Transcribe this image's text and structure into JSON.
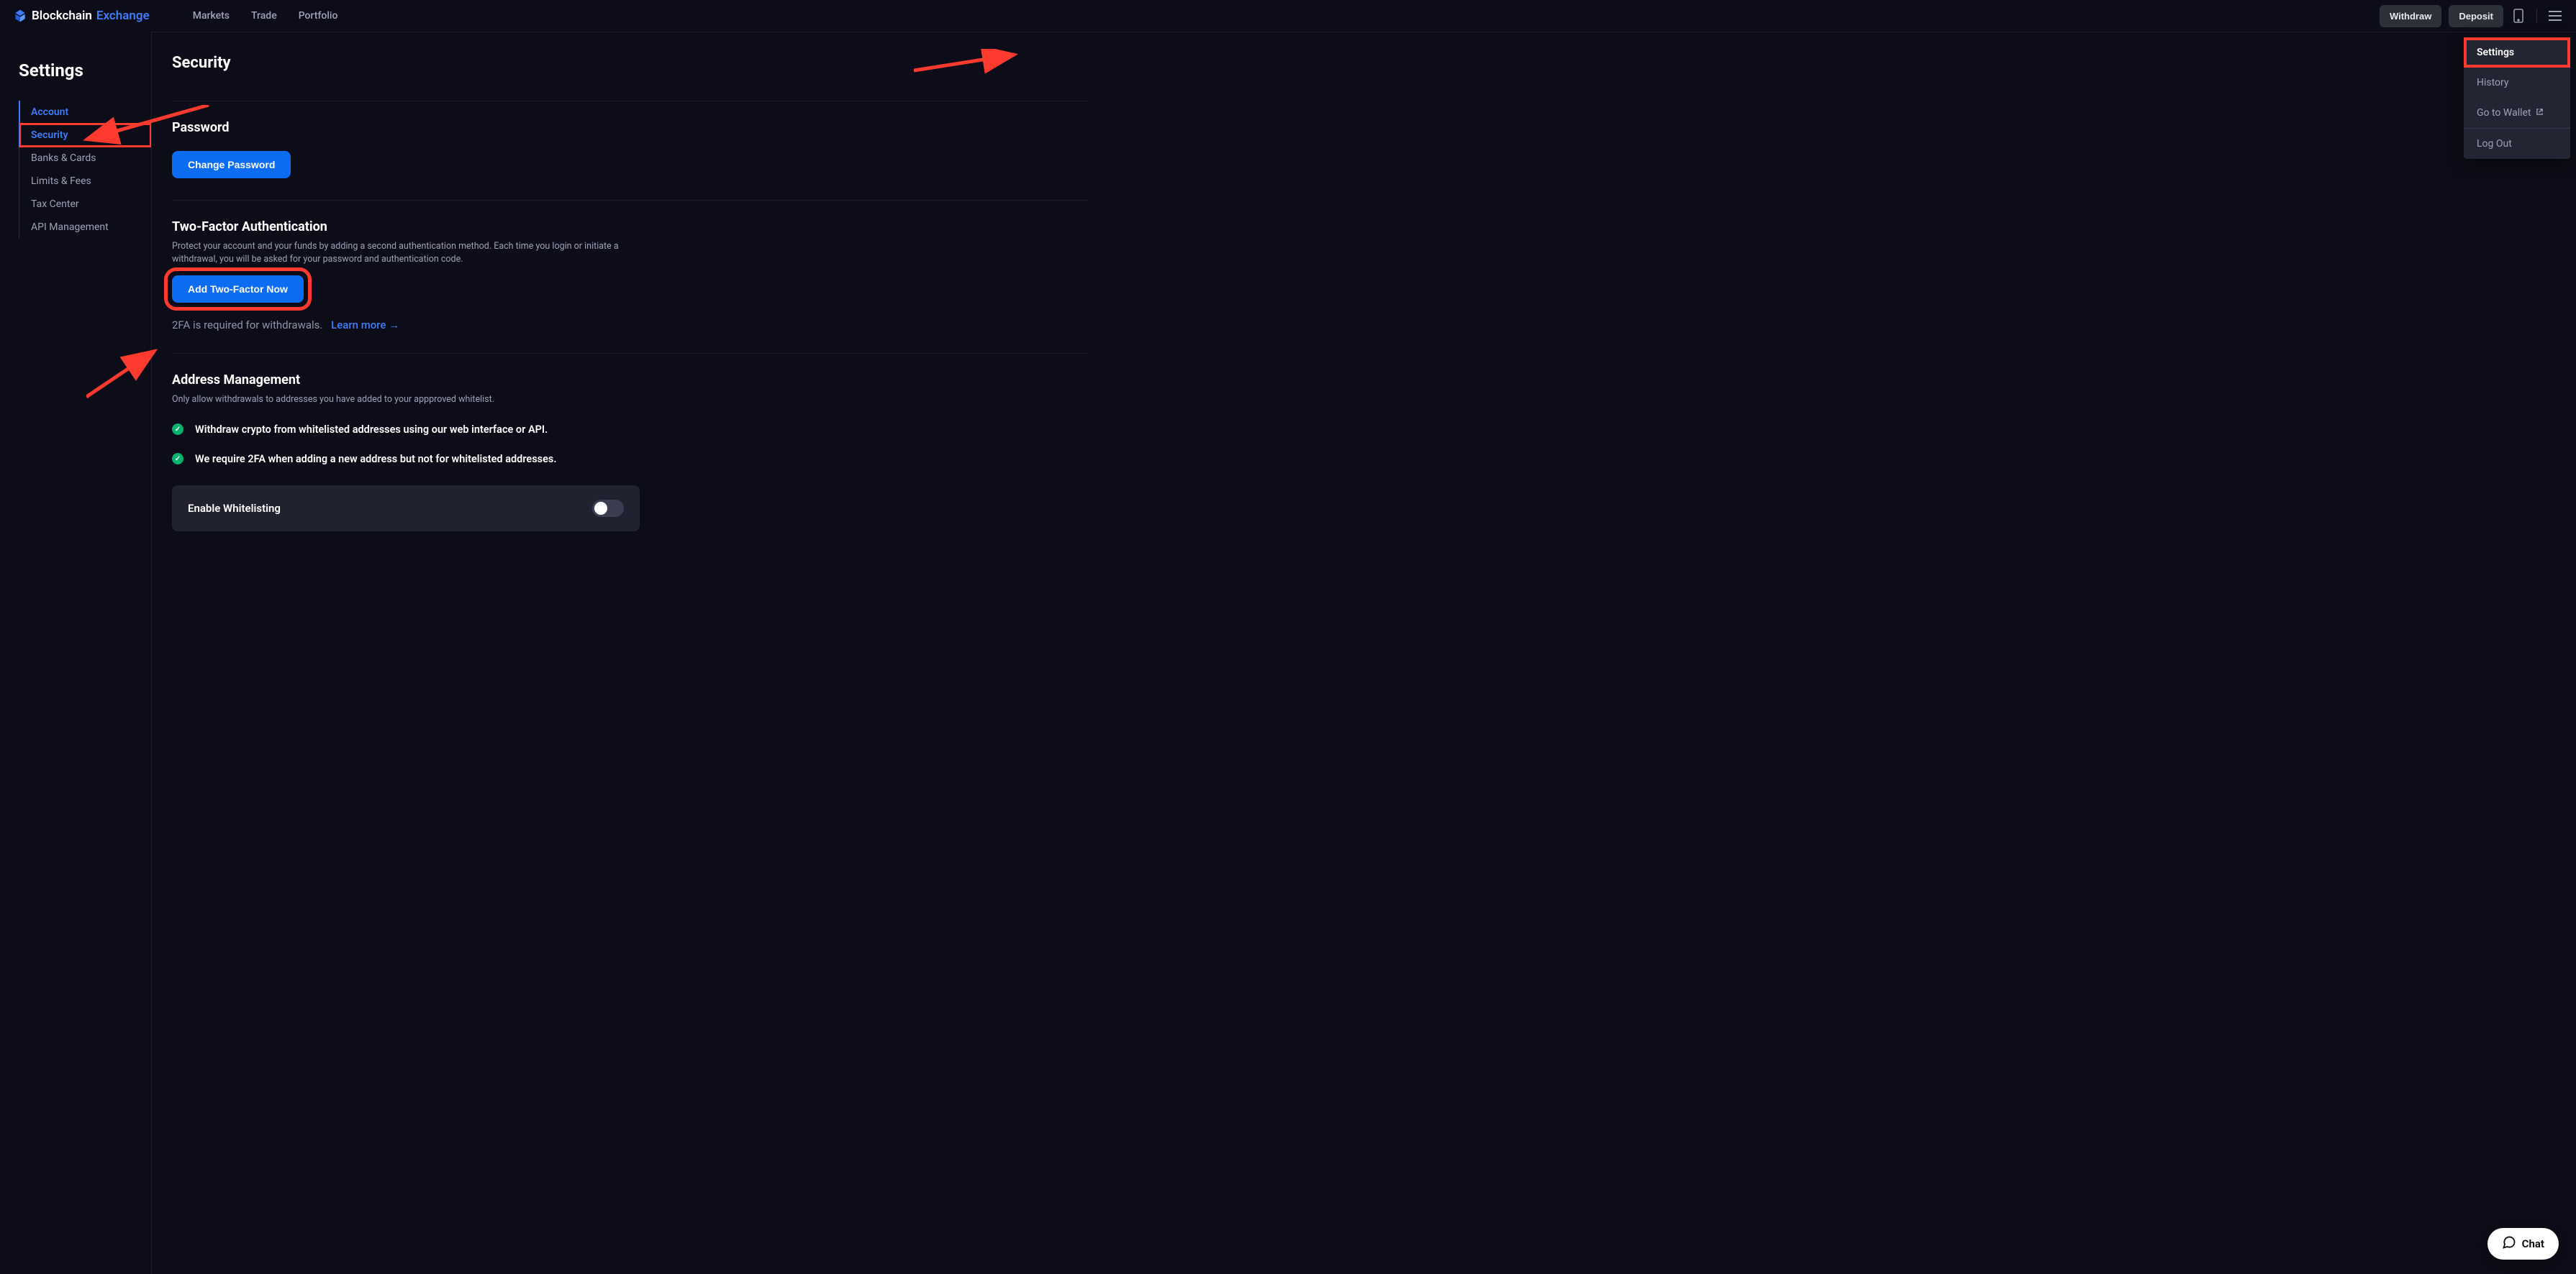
{
  "brand": {
    "word1": "Blockchain",
    "word2": "Exchange"
  },
  "nav": {
    "markets": "Markets",
    "trade": "Trade",
    "portfolio": "Portfolio"
  },
  "topbar": {
    "withdraw": "Withdraw",
    "deposit": "Deposit"
  },
  "dropdown": {
    "settings": "Settings",
    "history": "History",
    "go_to_wallet": "Go to Wallet",
    "log_out": "Log Out"
  },
  "sidebar": {
    "title": "Settings",
    "items": [
      "Account",
      "Security",
      "Banks & Cards",
      "Limits & Fees",
      "Tax Center",
      "API Management"
    ]
  },
  "page": {
    "heading": "Security"
  },
  "password": {
    "title": "Password",
    "button": "Change Password"
  },
  "twofa": {
    "title": "Two-Factor Authentication",
    "desc": "Protect your account and your funds by adding a second authentication method. Each time you login or initiate a withdrawal, you will be asked for your password and authentication code.",
    "button": "Add Two-Factor Now",
    "note": "2FA is required for withdrawals.",
    "learn_more": "Learn more"
  },
  "address": {
    "title": "Address Management",
    "desc": "Only allow withdrawals to addresses you have added to your appproved whitelist.",
    "bullet1": "Withdraw crypto from whitelisted addresses using our web interface or API.",
    "bullet2": "We require 2FA when adding a new address but not for whitelisted addresses.",
    "toggle_label": "Enable Whitelisting"
  },
  "chat": {
    "label": "Chat"
  }
}
